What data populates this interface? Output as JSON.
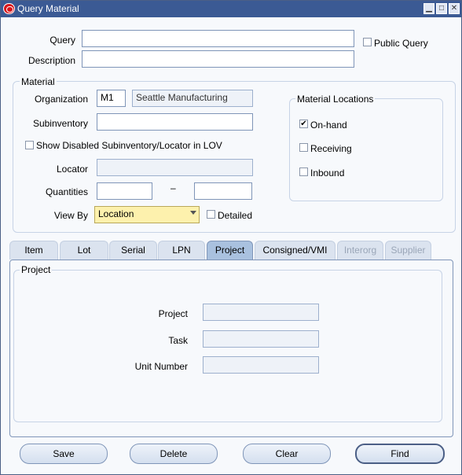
{
  "window": {
    "title": "Query Material"
  },
  "form": {
    "query_label": "Query",
    "query_value": "",
    "public_query_label": "Public Query",
    "description_label": "Description",
    "description_value": ""
  },
  "material": {
    "group_title": "Material",
    "organization_label": "Organization",
    "organization_code": "M1",
    "organization_name": "Seattle Manufacturing",
    "subinventory_label": "Subinventory",
    "subinventory_value": "",
    "show_disabled_label": "Show Disabled Subinventory/Locator in LOV",
    "locator_label": "Locator",
    "quantities_label": "Quantities",
    "quantities_separator": "–",
    "view_by_label": "View By",
    "view_by_value": "Location",
    "detailed_label": "Detailed"
  },
  "material_locations": {
    "title": "Material Locations",
    "onhand_label": "On-hand",
    "onhand_checked": true,
    "receiving_label": "Receiving",
    "inbound_label": "Inbound"
  },
  "tabs": [
    {
      "label": "Item"
    },
    {
      "label": "Lot"
    },
    {
      "label": "Serial"
    },
    {
      "label": "LPN"
    },
    {
      "label": "Project"
    },
    {
      "label": "Consigned/VMI"
    },
    {
      "label": "Interorg"
    },
    {
      "label": "Supplier"
    }
  ],
  "project_panel": {
    "group_title": "Project",
    "project_label": "Project",
    "task_label": "Task",
    "unit_number_label": "Unit Number"
  },
  "buttons": {
    "save": "Save",
    "delete": "Delete",
    "clear": "Clear",
    "find": "Find"
  }
}
